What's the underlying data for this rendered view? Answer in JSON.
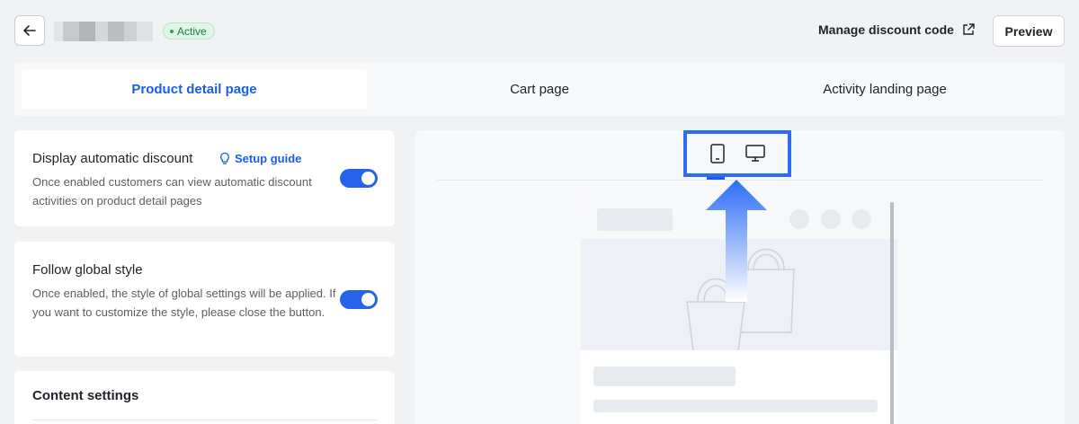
{
  "header": {
    "status_badge": "Active",
    "manage_link": "Manage discount code",
    "preview_button": "Preview"
  },
  "tabs": [
    {
      "label": "Product detail page",
      "active": true
    },
    {
      "label": "Cart page",
      "active": false
    },
    {
      "label": "Activity landing page",
      "active": false
    }
  ],
  "settings": {
    "auto_discount": {
      "title": "Display automatic discount",
      "setup_link": "Setup guide",
      "description": "Once enabled customers can view automatic discount activities on product detail pages",
      "enabled": true
    },
    "global_style": {
      "title": "Follow global style",
      "description": "Once enabled, the style of global settings will be applied. If you want to customize the style, please close the button.",
      "enabled": true
    },
    "content": {
      "title": "Content settings"
    }
  },
  "preview": {
    "devices": [
      "mobile-icon",
      "desktop-icon"
    ],
    "selected_device": "mobile"
  },
  "colors": {
    "accent": "#1b5cf0",
    "highlight_box": "#2d6df6",
    "badge_bg": "#dff5e7"
  }
}
